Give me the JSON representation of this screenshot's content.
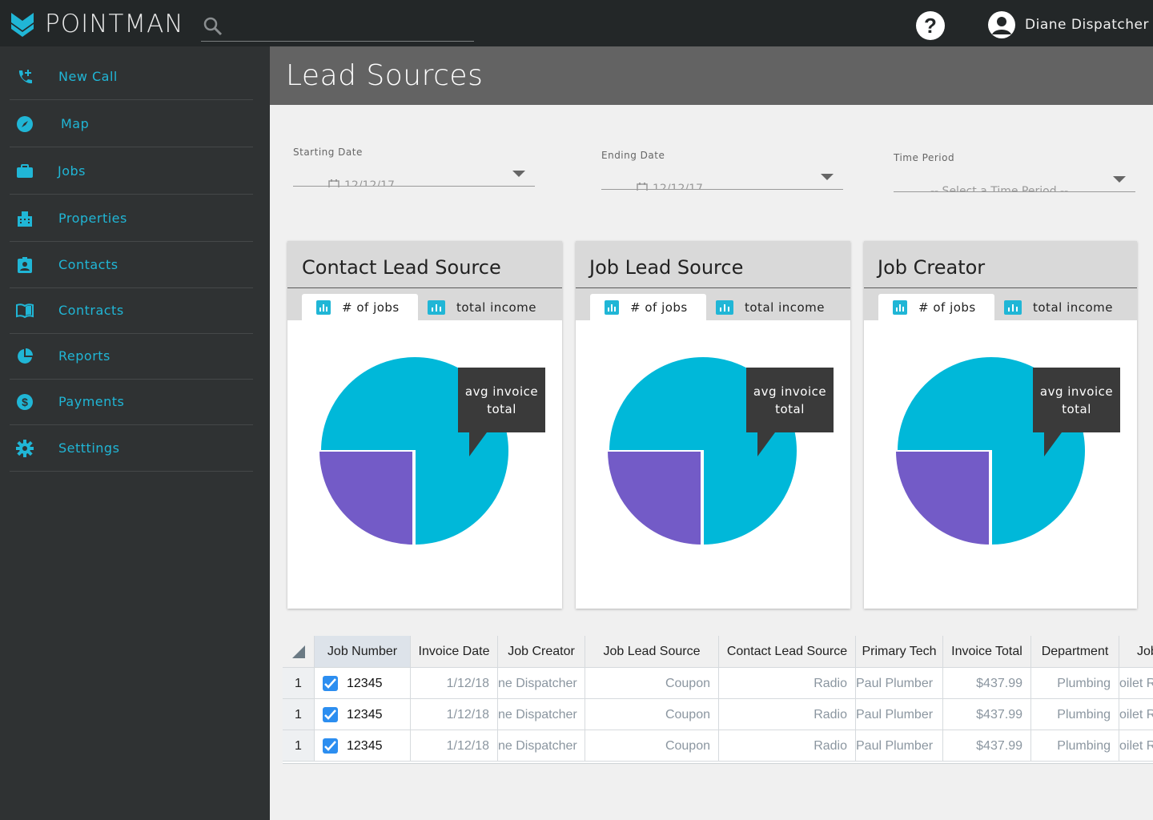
{
  "app": {
    "name": "POINTMAN",
    "brand_color": "#20b6d6",
    "user_name": "Diane Dispatcher",
    "help_label": "?"
  },
  "sidebar": {
    "items": [
      {
        "label": "New Call",
        "icon": "phone-add-icon"
      },
      {
        "label": "Map",
        "icon": "compass-icon"
      },
      {
        "label": "Jobs",
        "icon": "briefcase-icon"
      },
      {
        "label": "Properties",
        "icon": "building-icon"
      },
      {
        "label": "Contacts",
        "icon": "contact-badge-icon"
      },
      {
        "label": "Contracts",
        "icon": "book-icon"
      },
      {
        "label": "Reports",
        "icon": "pie-chart-icon"
      },
      {
        "label": "Payments",
        "icon": "dollar-icon"
      },
      {
        "label": "Setttings",
        "icon": "gear-icon"
      }
    ]
  },
  "page": {
    "title": "Lead Sources"
  },
  "filters": {
    "start": {
      "label": "Starting Date",
      "value": "12/12/17"
    },
    "end": {
      "label": "Ending Date",
      "value": "12/12/17"
    },
    "period": {
      "label": "Time Period",
      "value": "-- Select a Time Period --"
    }
  },
  "cards": [
    {
      "title": "Contact Lead Source",
      "tab_jobs": "# of jobs",
      "tab_income": "total income",
      "tooltip_l1": "avg invoice",
      "tooltip_l2": "total"
    },
    {
      "title": "Job Lead Source",
      "tab_jobs": "# of jobs",
      "tab_income": "total income",
      "tooltip_l1": "avg invoice",
      "tooltip_l2": "total"
    },
    {
      "title": "Job Creator",
      "tab_jobs": "# of jobs",
      "tab_income": "total income",
      "tooltip_l1": "avg invoice",
      "tooltip_l2": "total"
    }
  ],
  "chart_data": [
    {
      "type": "pie",
      "values": [
        75,
        25
      ],
      "colors": [
        "#00b8d9",
        "#735bc7"
      ]
    },
    {
      "type": "pie",
      "values": [
        75,
        25
      ],
      "colors": [
        "#00b8d9",
        "#735bc7"
      ]
    },
    {
      "type": "pie",
      "values": [
        75,
        25
      ],
      "colors": [
        "#00b8d9",
        "#735bc7"
      ]
    }
  ],
  "table": {
    "columns": [
      "Job Number",
      "Invoice Date",
      "Job Creator",
      "Job Lead Source",
      "Contact Lead Source",
      "Primary Tech",
      "Invoice Total",
      "Department",
      "Job"
    ],
    "rows": [
      {
        "n": "1",
        "job": "12345",
        "date": "1/12/18",
        "creator": "ne Dispatcher",
        "jls": "Coupon",
        "cls": "Radio",
        "tech": "Paul Plumber",
        "total": "$437.99",
        "dept": "Plumbing",
        "jobtype": "oilet R"
      },
      {
        "n": "1",
        "job": "12345",
        "date": "1/12/18",
        "creator": "ne Dispatcher",
        "jls": "Coupon",
        "cls": "Radio",
        "tech": "Paul Plumber",
        "total": "$437.99",
        "dept": "Plumbing",
        "jobtype": "oilet R"
      },
      {
        "n": "1",
        "job": "12345",
        "date": "1/12/18",
        "creator": "ne Dispatcher",
        "jls": "Coupon",
        "cls": "Radio",
        "tech": "Paul Plumber",
        "total": "$437.99",
        "dept": "Plumbing",
        "jobtype": "oilet R"
      }
    ]
  }
}
